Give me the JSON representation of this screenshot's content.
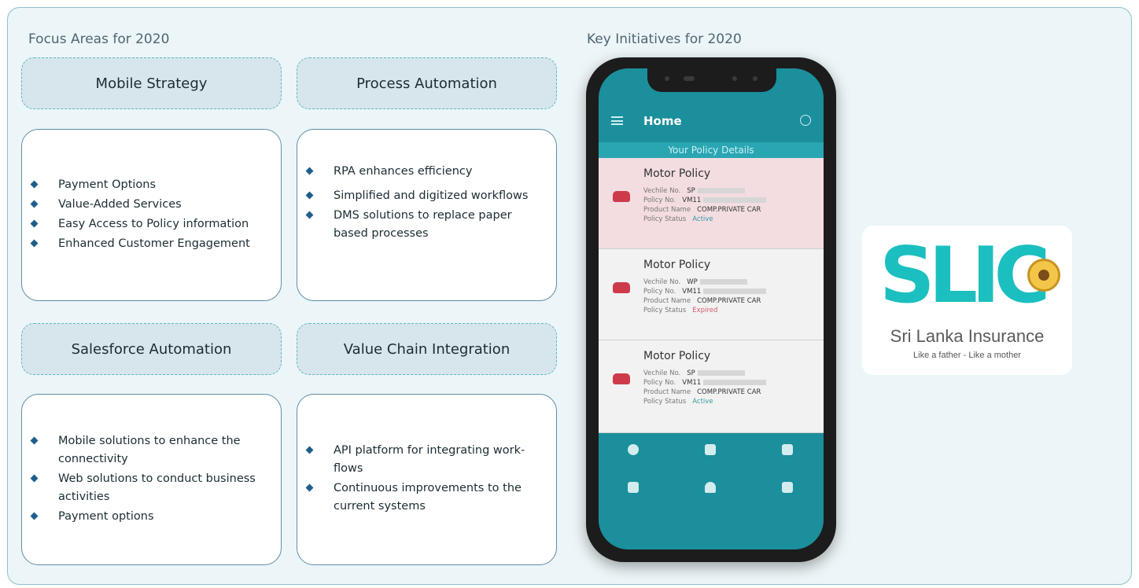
{
  "focus_title": "Focus Areas for 2020",
  "initiatives_title": "Key Initiatives for 2020",
  "areas": [
    {
      "title": "Mobile Strategy",
      "items": [
        "Payment Options",
        "Value-Added Services",
        "Easy Access to Policy information",
        "Enhanced Customer Engagement"
      ]
    },
    {
      "title": "Process Automation",
      "items": [
        "RPA enhances efficiency",
        "Simplified and digitized workflows",
        "DMS solutions to replace paper based processes"
      ]
    },
    {
      "title": "Salesforce Automation",
      "items": [
        "Mobile solutions to enhance the connectivity",
        "Web solutions to conduct business activities",
        "Payment options"
      ]
    },
    {
      "title": "Value Chain Integration",
      "items": [
        "API platform for integrating work-flows",
        "Continuous improvements to the current systems"
      ]
    }
  ],
  "phone": {
    "app_title": "Home",
    "section_header": "Your Policy Details",
    "policies": [
      {
        "title": "Motor Policy",
        "vehicle_label": "Vechile No.",
        "vehicle_value": "SP",
        "policy_label": "Policy No.",
        "policy_value": "VM11",
        "product_label": "Product Name",
        "product_value": "COMP.PRIVATE CAR",
        "status_label": "Policy Status",
        "status_value": "Active",
        "status_color": "#3a9aa4",
        "background": "#f3dde0"
      },
      {
        "title": "Motor Policy",
        "vehicle_label": "Vechile No.",
        "vehicle_value": "WP",
        "policy_label": "Policy No.",
        "policy_value": "VM11",
        "product_label": "Product Name",
        "product_value": "COMP.PRIVATE CAR",
        "status_label": "Policy Status",
        "status_value": "Expired",
        "status_color": "#d45a6a",
        "background": "#f2f2f2"
      },
      {
        "title": "Motor Policy",
        "vehicle_label": "Vechile No.",
        "vehicle_value": "SP",
        "policy_label": "Policy No.",
        "policy_value": "VM11",
        "product_label": "Product Name",
        "product_value": "COMP.PRIVATE CAR",
        "status_label": "Policy Status",
        "status_value": "Active",
        "status_color": "#3a9aa4",
        "background": "#f2f2f2"
      }
    ]
  },
  "logo": {
    "wordmark": "SLIC",
    "name": "Sri Lanka Insurance",
    "tagline": "Like a father - Like a mother"
  }
}
